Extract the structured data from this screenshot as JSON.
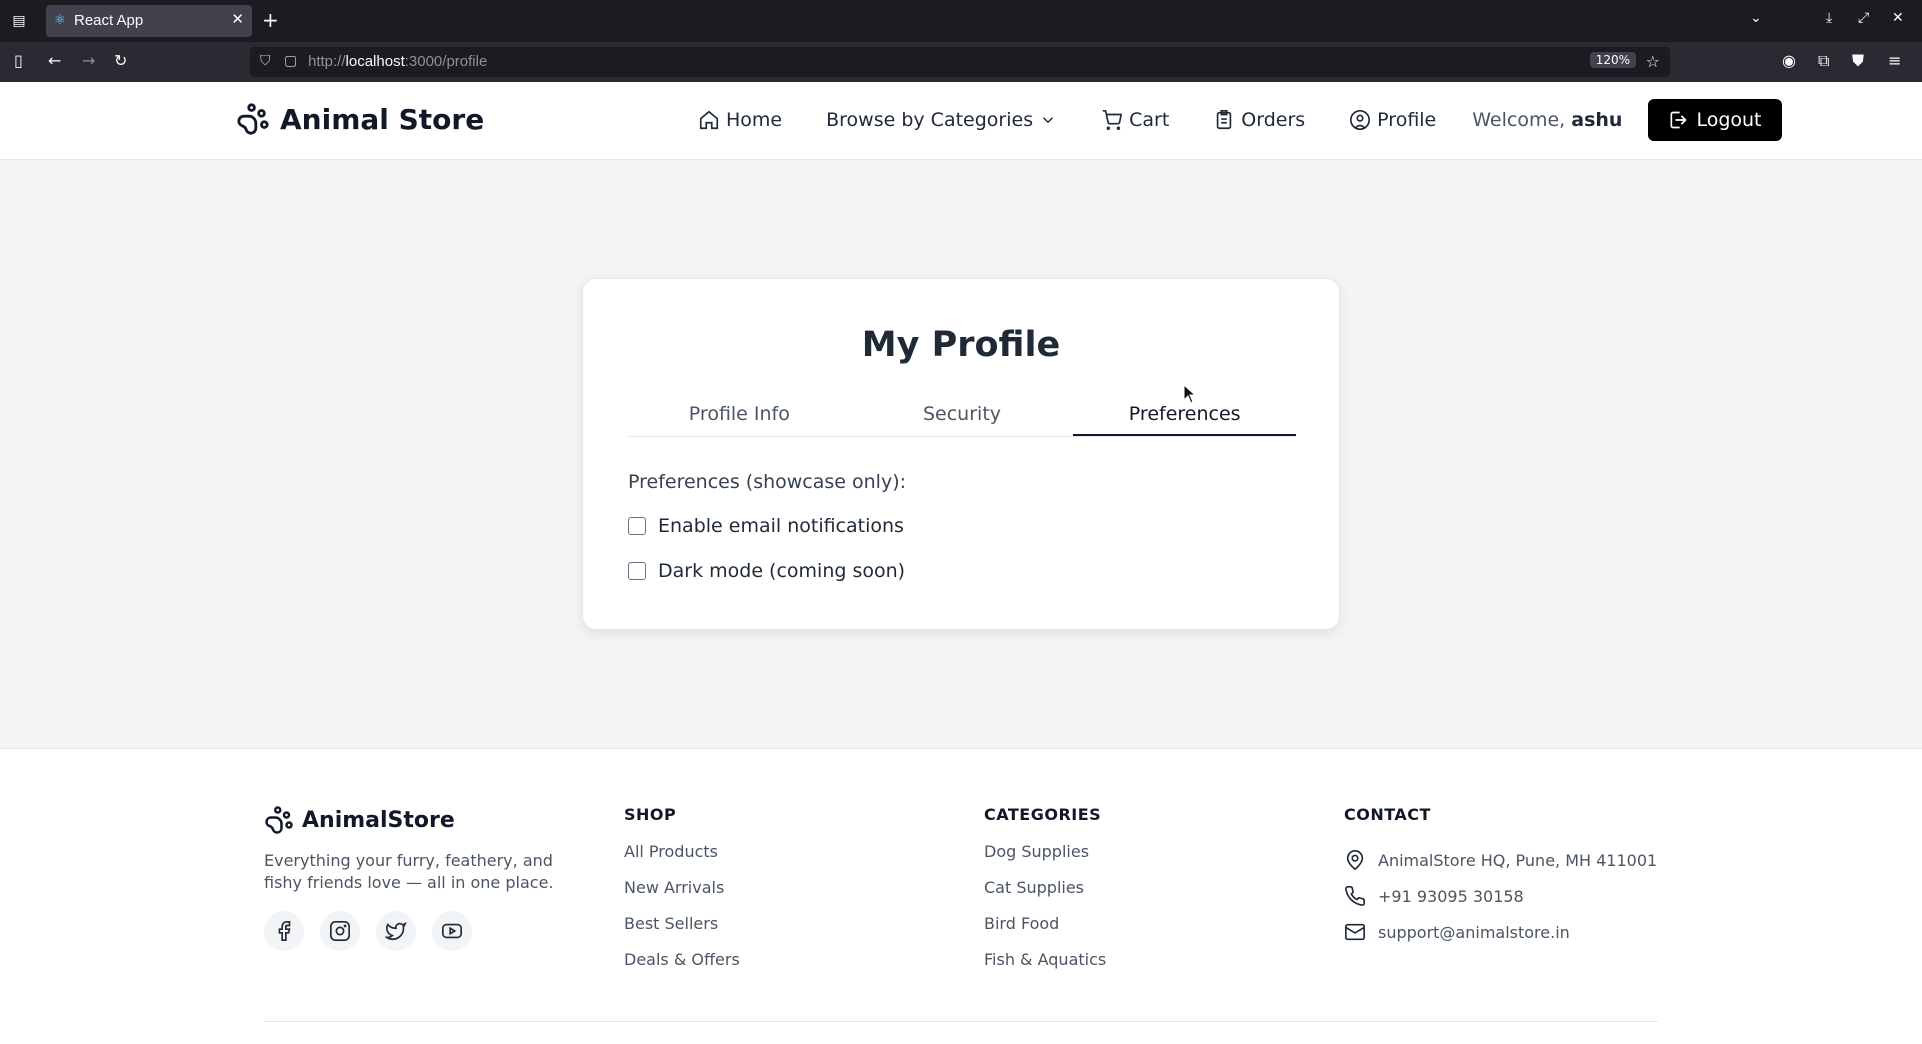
{
  "browser": {
    "tab_title": "React App",
    "url_scheme": "http://",
    "url_host": "localhost",
    "url_path": ":3000/profile",
    "zoom": "120%"
  },
  "header": {
    "brand": "Animal Store",
    "nav": {
      "home": "Home",
      "browse": "Browse by Categories",
      "cart": "Cart",
      "orders": "Orders",
      "profile": "Profile"
    },
    "welcome_prefix": "Welcome,",
    "username": "ashu",
    "logout": "Logout"
  },
  "profile": {
    "title": "My Profile",
    "tabs": [
      "Profile Info",
      "Security",
      "Preferences"
    ],
    "active_tab": "Preferences",
    "preferences_label": "Preferences (showcase only):",
    "options": [
      {
        "label": "Enable email notifications",
        "checked": false
      },
      {
        "label": "Dark mode (coming soon)",
        "checked": false
      }
    ]
  },
  "footer": {
    "brand": "AnimalStore",
    "tagline": "Everything your furry, feathery, and fishy friends love — all in one place.",
    "shop": {
      "heading": "SHOP",
      "links": [
        "All Products",
        "New Arrivals",
        "Best Sellers",
        "Deals & Offers"
      ]
    },
    "categories": {
      "heading": "CATEGORIES",
      "links": [
        "Dog Supplies",
        "Cat Supplies",
        "Bird Food",
        "Fish & Aquatics"
      ]
    },
    "contact": {
      "heading": "CONTACT",
      "address": "AnimalStore HQ, Pune, MH 411001",
      "phone": "+91 93095 30158",
      "email": "support@animalstore.in"
    },
    "socials": [
      "facebook-icon",
      "instagram-icon",
      "twitter-icon",
      "youtube-icon"
    ]
  },
  "colors": {
    "accent": "#000000",
    "page_bg": "#f3f4f6"
  }
}
